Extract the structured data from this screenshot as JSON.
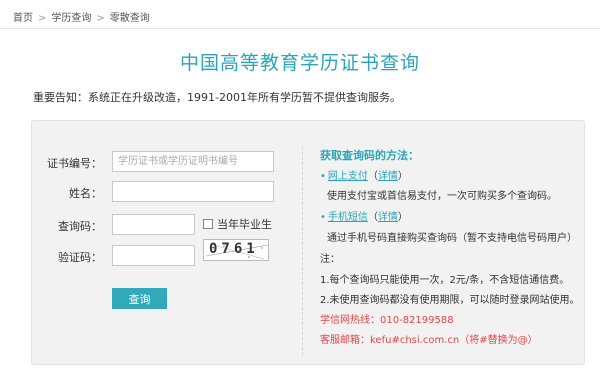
{
  "breadcrumb": {
    "home": "首页",
    "sep1": ">",
    "section": "学历查询",
    "sep2": ">",
    "current": "零散查询"
  },
  "title": "中国高等教育学历证书查询",
  "notice": "重要告知：系统正在升级改造，1991-2001年所有学历暂不提供查询服务。",
  "form": {
    "cert_label": "证书编号：",
    "cert_placeholder": "学历证书或学历证明书编号",
    "name_label": "姓名：",
    "query_code_label": "查询码：",
    "graduate_label": "当年毕业生",
    "captcha_label": "验证码：",
    "captcha_text": "0761",
    "submit_label": "查询"
  },
  "help": {
    "title": "获取查询码的方法：",
    "online_pay_bullet": "•",
    "online_pay_link": "网上支付",
    "online_pay_paren_open": "（",
    "online_pay_detail": "详情",
    "online_pay_paren_close": "）",
    "online_pay_desc": "使用支付宝或首信易支付，一次可购买多个查询码。",
    "sms_bullet": "•",
    "sms_link": "手机短信",
    "sms_paren_open": "（",
    "sms_detail": "详情",
    "sms_paren_close": "）",
    "sms_desc": "通过手机号码直接购买查询码（暂不支持电信号码用户）",
    "note_label": "注：",
    "note1": "1.每个查询码只能使用一次，2元/条，不含短信通信费。",
    "note2": "2.未使用查询码都没有使用期限，可以随时登录网站使用。",
    "hotline": "学信网热线：010-82199588",
    "email": "客服邮箱：kefu#chsi.com.cn（将#替换为@）"
  },
  "colors": {
    "accent": "#2aa6b8",
    "button": "#32a9bb",
    "warning": "#e04848",
    "panel": "#f2f2f2"
  }
}
